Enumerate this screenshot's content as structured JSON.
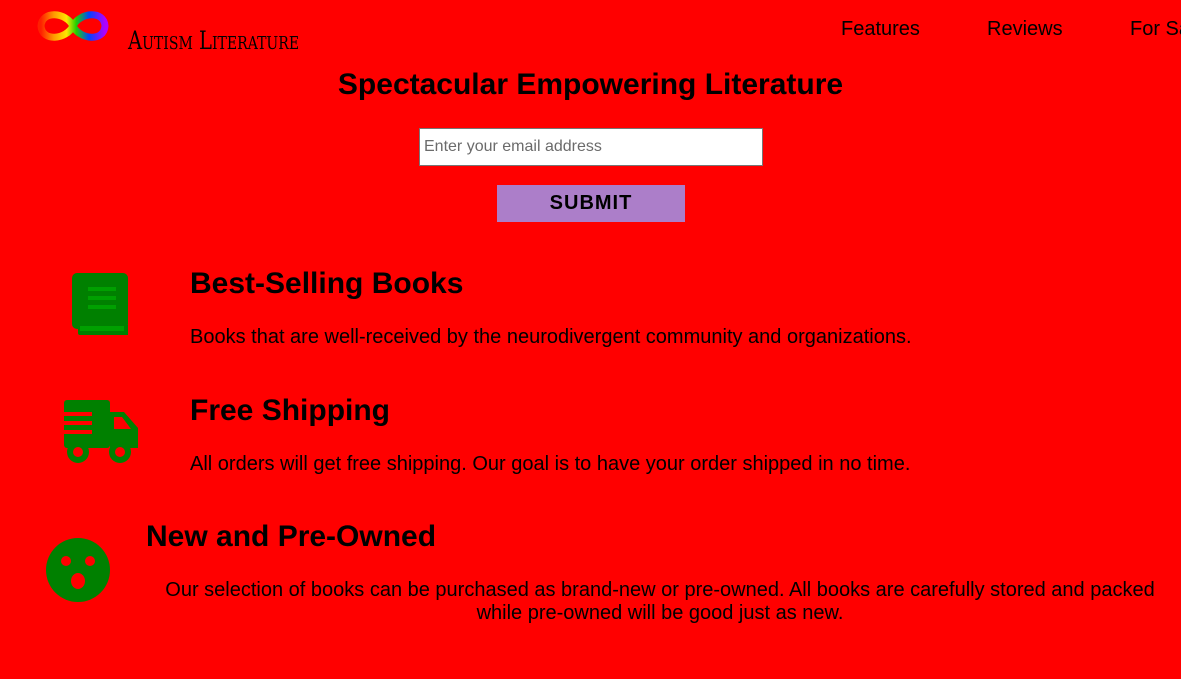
{
  "header": {
    "brand": "Autism Literature",
    "nav": [
      {
        "label": "Features"
      },
      {
        "label": "Reviews"
      },
      {
        "label": "For Sale"
      }
    ]
  },
  "hero": {
    "headline": "Spectacular Empowering Literature",
    "email_placeholder": "Enter your email address",
    "submit_label": "SUBMIT"
  },
  "features": [
    {
      "icon": "book-icon",
      "title": "Best-Selling Books",
      "description": "Books that are well-received by the neurodivergent community and organizations."
    },
    {
      "icon": "shipping-truck-icon",
      "title": "Free Shipping",
      "description": "All orders will get free shipping. Our goal is to have your order shipped in no time."
    },
    {
      "icon": "surprised-face-icon",
      "title": "New and Pre-Owned",
      "description": "Our selection of books can be purchased as brand-new or pre-owned. All books are carefully stored and packed while pre-owned will be good just as new."
    }
  ],
  "colors": {
    "background": "#ff0000",
    "icon": "#008000",
    "button": "#ac7ec9"
  }
}
